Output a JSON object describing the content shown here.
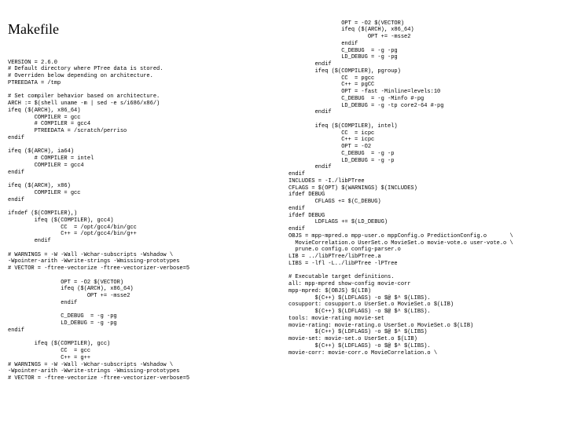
{
  "title": "Makefile",
  "left": "VERSION = 2.6.0\n# Default directory where PTree data is stored.\n# Overriden below depending on architecture.\nPTREEDATA = /tmp\n\n# Set compiler behavior based on architecture.\nARCH := $(shell uname -m | sed -e s/i686/x86/)\nifeq ($(ARCH), x86_64)\n        COMPILER = gcc\n        # COMPILER = gcc4\n        PTREEDATA = /scratch/perriso\nendif\n\nifeq ($(ARCH), ia64)\n        # COMPILER = intel\n        COMPILER = gcc4\nendif\n\nifeq ($(ARCH), x86)\n        COMPILER = gcc\nendif\n\nifndef ($(COMPILER),)\n        ifeq ($(COMPILER), gcc4)\n                CC  = /opt/gcc4/bin/gcc\n                C++ = /opt/gcc4/bin/g++\n        endif\n\n# WARNINGS = -W -Wall -Wchar-subscripts -Wshadow \\\n-Wpointer-arith -Wwrite-strings -Wmissing-prototypes\n# VECTOR = -ftree-vectorize -ftree-vectorizer-verbose=5\n\n                OPT = -O2 $(VECTOR)\n                ifeq ($(ARCH), x86_64)\n                        OPT += -msse2\n                endif\n\n                C_DEBUG  = -g -pg\n                LD_DEBUG = -g -pg\nendif\n\n        ifeq ($(COMPILER), gcc)\n                CC  = gcc\n                C++ = g++\n# WARNINGS = -W -Wall -Wchar-subscripts -Wshadow \\\n-Wpointer-arith -Wwrite-strings -Wmissing-prototypes\n# VECTOR = -ftree-vectorize -ftree-vectorizer-verbose=5",
  "right": "                OPT = -O2 $(VECTOR)\n                ifeq ($(ARCH), x86_64)\n                        OPT += -msse2\n                endif\n                C_DEBUG  = -g -pg\n                LD_DEBUG = -g -pg\n        endif\n        ifeq ($(COMPILER), pgroup)\n                CC  = pgcc\n                C++ = pgCC\n                OPT = -fast -Minline=levels:10\n                C_DEBUG  = -g -Minfo #-pg\n                LD_DEBUG = -g -tp core2-64 #-pg\n        endif\n\n        ifeq ($(COMPILER), intel)\n                CC  = icpc\n                C++ = icpc\n                OPT = -O2\n                C_DEBUG  = -g -p\n                LD_DEBUG = -g -p\n        endif\nendif\nINCLUDES = -I./libPTree\nCFLAGS = $(OPT) $(WARNINGS) $(INCLUDES)\nifdef DEBUG\n        CFLAGS += $(C_DEBUG)\nendif\nifdef DEBUG\n        LDFLAGS += $(LD_DEBUG)\nendif\nOBJS = mpp-mpred.o mpp-user.o mppConfig.o PredictionConfig.o       \\\n  MovieCorrelation.o UserSet.o MovieSet.o movie-vote.o user-vote.o \\\n  prune.o config.o config-parser.o\nLIB = ../libPTree/libPTree.a\nLIBS = -lfl -L../libPTree -lPTree\n\n# Executable target definitions.\nall: mpp-mpred show-config movie-corr\nmpp-mpred: $(OBJS) $(LIB)\n        $(C++) $(LDFLAGS) -o $@ $^ $(LIBS).\ncosupport: cosupport.o UserSet.o MovieSet.o $(LIB)\n        $(C++) $(LDFLAGS) -o $@ $^ $(LIBS).\ntools: movie-rating movie-set\nmovie-rating: movie-rating.o UserSet.o MovieSet.o $(LIB)\n        $(C++) $(LDFLAGS) -o $@ $^ $(LIBS)\nmovie-set: movie-set.o UserSet.o $(LIB)\n        $(C++) $(LDFLAGS) -o $@ $^ $(LIBS).\nmovie-corr: movie-corr.o MovieCorrelation.o \\"
}
